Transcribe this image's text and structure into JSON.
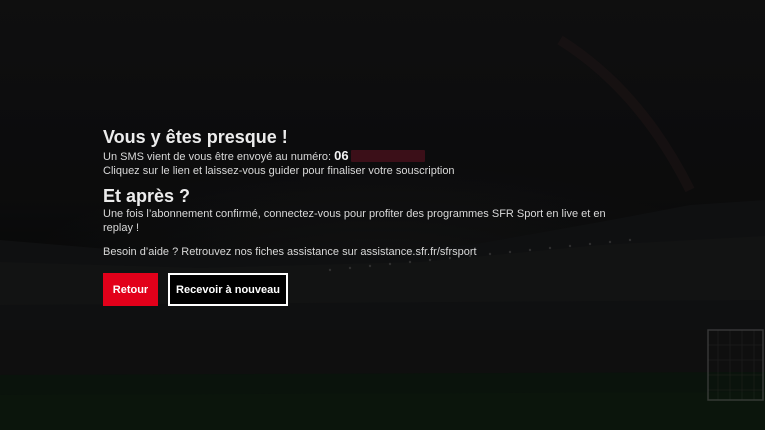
{
  "dialog": {
    "title": "Vous y êtes presque !",
    "sms_text": "Un SMS vient de vous être envoyé au numéro:",
    "phone_prefix": "06",
    "instruction": "Cliquez sur le lien et laissez-vous guider pour finaliser votre souscription",
    "after_title": "Et après ?",
    "after_text": "Une fois l’abonnement confirmé, connectez-vous pour profiter des programmes SFR Sport en live et en replay !",
    "help_text": "Besoin d’aide ? Retrouvez nos fiches assistance sur assistance.sfr.fr/sfrsport"
  },
  "buttons": {
    "back_label": "Retour",
    "resend_label": "Recevoir à nouveau"
  },
  "colors": {
    "accent": "#e2001a",
    "masked_number": "#3b0f18",
    "background": "#0c0c0d"
  }
}
